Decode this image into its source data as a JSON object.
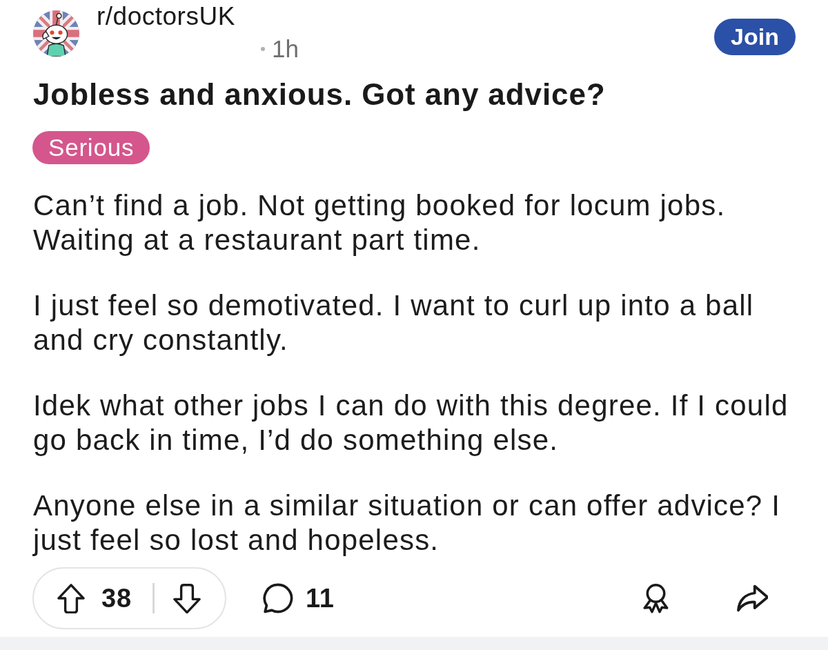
{
  "header": {
    "community": "r/doctorsUK",
    "age": "1h",
    "join_label": "Join"
  },
  "post": {
    "title": "Jobless and anxious. Got any advice?",
    "flair": "Serious",
    "paragraphs": [
      "Can’t find a job. Not getting booked for locum jobs. Waiting at a restaurant part time.",
      "I just feel so demotivated. I want to curl up into a ball and cry constantly.",
      "Idek what other jobs I can do with this degree. If I could go back in time, I’d do something else.",
      "Anyone else in a similar situation or can offer advice? I just feel so lost and hopeless."
    ]
  },
  "actions": {
    "upvotes": "38",
    "comments": "11"
  }
}
